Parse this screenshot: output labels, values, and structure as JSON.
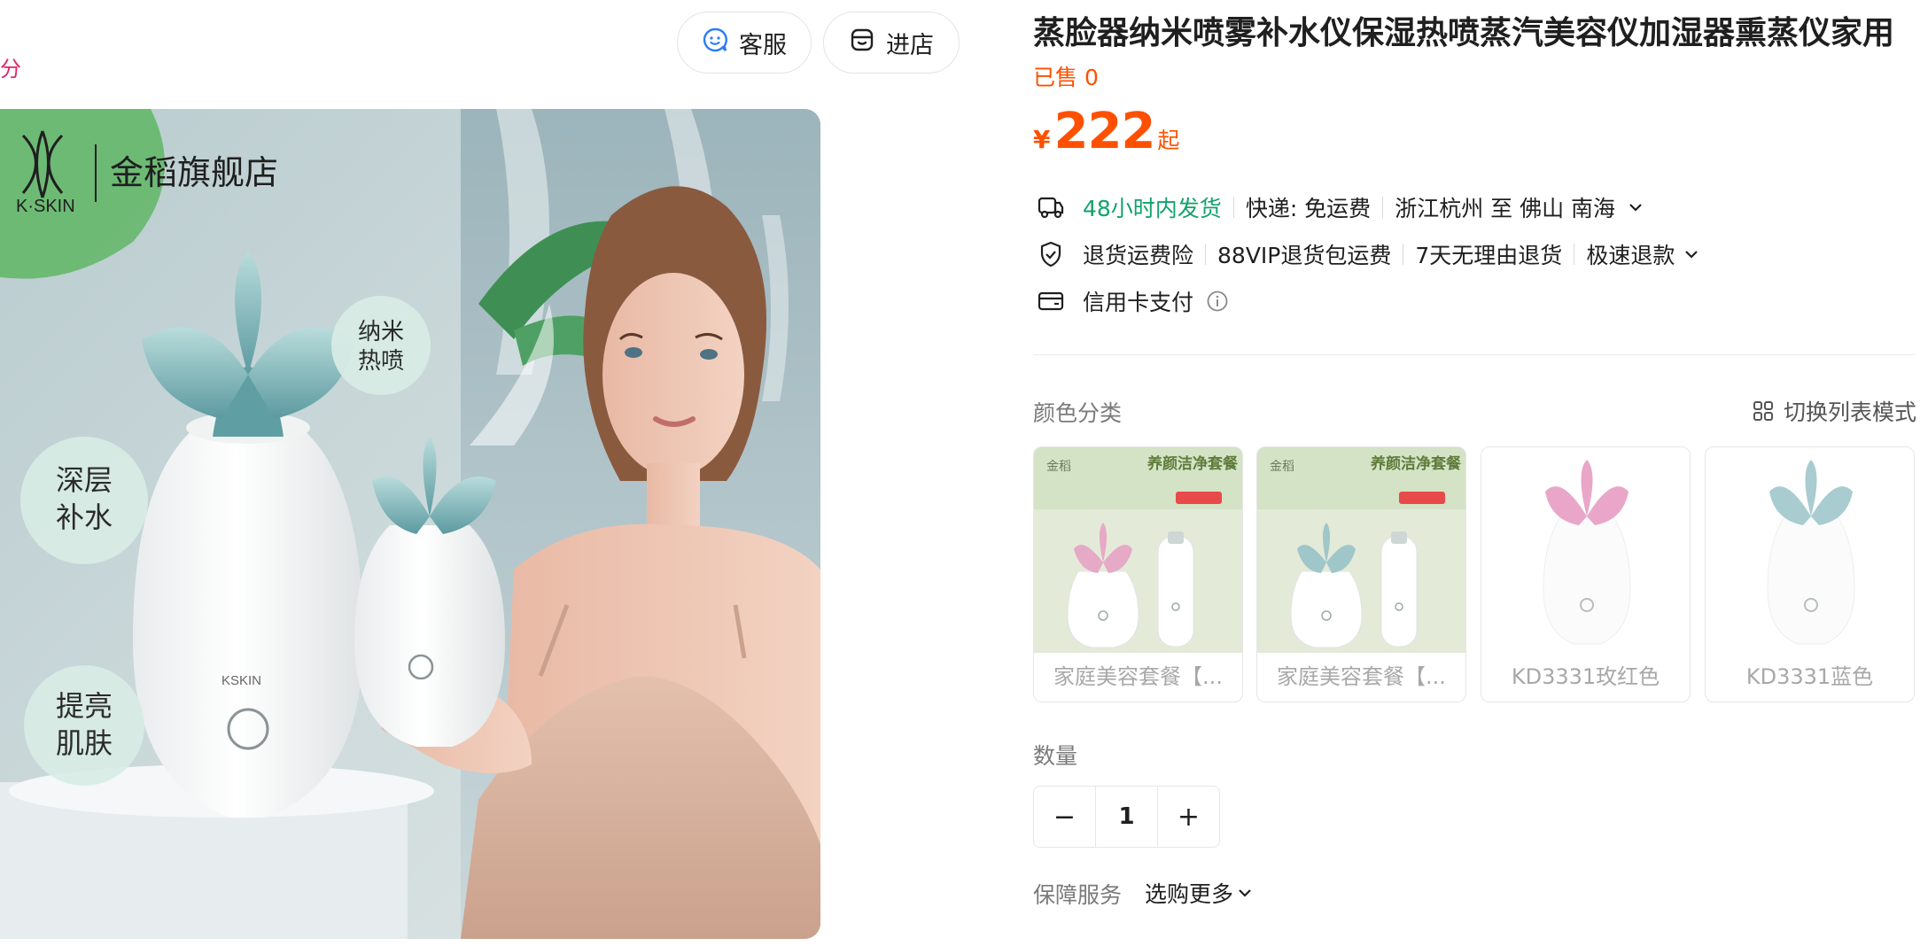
{
  "rating_snippet": "评分",
  "header_buttons": {
    "service_label": "客服",
    "shop_label": "进店"
  },
  "product_image": {
    "logo_text": "K·SKIN",
    "store_name": "金稻旗舰店",
    "badges": [
      "深层\n补水",
      "纳米\n热喷",
      "提亮\n肌肤"
    ],
    "device_brand": "KSKIN"
  },
  "product": {
    "title": "蒸脸器纳米喷雾补水仪保湿热喷蒸汽美容仪加湿器熏蒸仪家用",
    "sold": "已售 0",
    "price_currency": "¥",
    "price": "222",
    "price_suffix": "起"
  },
  "shipping": {
    "dispatch": "48小时内发货",
    "express": "快递: 免运费",
    "route": "浙江杭州 至 佛山 南海"
  },
  "services": {
    "items": [
      "退货运费险",
      "88VIP退货包运费",
      "7天无理由退货",
      "极速退款"
    ]
  },
  "payment": {
    "label": "信用卡支付"
  },
  "color_section": {
    "label": "颜色分类",
    "switch_label": "切换列表模式",
    "options": [
      {
        "label": "家庭美容套餐【...",
        "banner": "养颜洁净套餐",
        "brand": "金稻",
        "accent": "#e6a9c6"
      },
      {
        "label": "家庭美容套餐【...",
        "banner": "养颜洁净套餐",
        "brand": "金稻",
        "accent": "#9fc6c8"
      },
      {
        "label": "KD3331玫红色",
        "accent": "#e9a6c9"
      },
      {
        "label": "KD3331蓝色",
        "accent": "#a9ccd0"
      }
    ]
  },
  "quantity": {
    "label": "数量",
    "value": "1",
    "minus": "−",
    "plus": "+"
  },
  "guarantee": {
    "label": "保障服务",
    "select_label": "选购更多"
  },
  "colors": {
    "price": "#ff5000",
    "dispatch_green": "#12a26b",
    "rating_pink": "#e3256b"
  }
}
